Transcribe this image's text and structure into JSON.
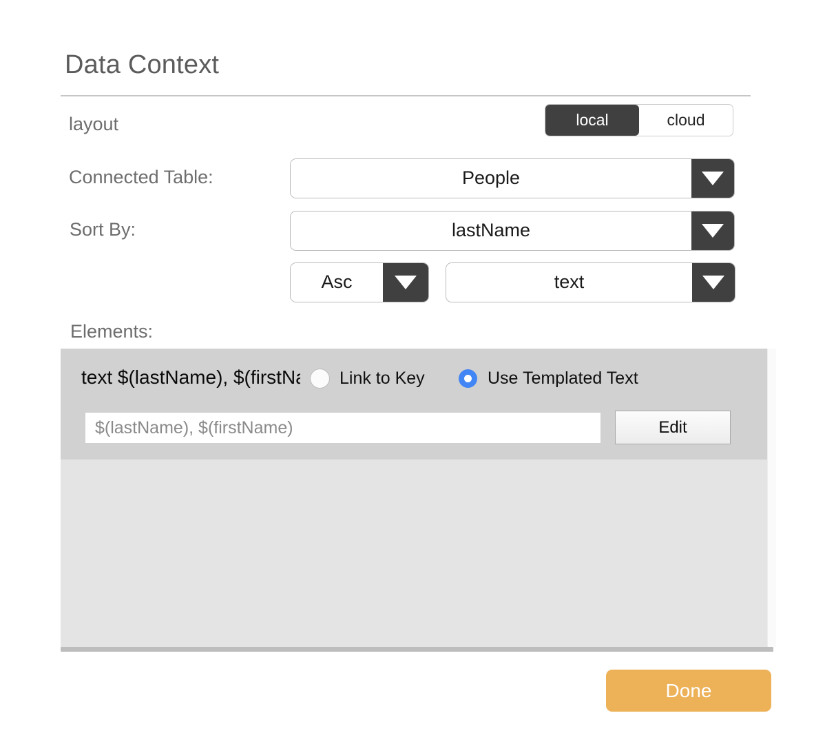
{
  "dialog": {
    "title": "Data Context"
  },
  "storage_toggle": {
    "label": "layout",
    "options": [
      "local",
      "cloud"
    ],
    "selected": "local"
  },
  "connected_table": {
    "label": "Connected Table:",
    "value": "People"
  },
  "sort_by": {
    "label": "Sort By:",
    "value": "lastName",
    "direction": "Asc",
    "type": "text"
  },
  "elements": {
    "label": "Elements:",
    "selected_element": {
      "title": "text $(lastName), $(firstName)",
      "mode_options": [
        {
          "label": "Link to Key",
          "selected": false
        },
        {
          "label": "Use Templated Text",
          "selected": true
        }
      ],
      "template_value": "$(lastName), $(firstName)",
      "template_placeholder": "$(lastName), $(firstName)",
      "edit_label": "Edit"
    }
  },
  "footer": {
    "done_label": "Done"
  },
  "colors": {
    "accent_selected": "#404040",
    "radio_selected": "#4285f4",
    "done_button": "#edb158",
    "panel_background": "#e4e4e4",
    "row_background": "#d1d1d1",
    "label_text": "#6d6d6d"
  },
  "icons": {
    "dropdown_arrow": "chevron-down-icon"
  }
}
